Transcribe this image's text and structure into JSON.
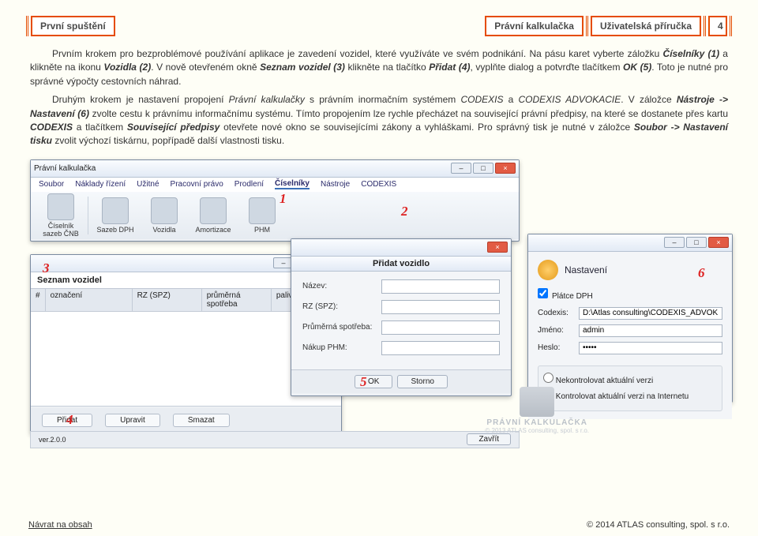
{
  "header": {
    "left": "První spuštění",
    "mid1": "Právní kalkulačka",
    "mid2": "Uživatelská příručka",
    "page": "4"
  },
  "p1_a": "Prvním krokem pro bezproblémové používání aplikace je zavedení vozidel, které využíváte ve svém podnikání. Na pásu karet vyberte záložku ",
  "p1_b": "Číselníky (1)",
  "p1_c": " a klikněte na ikonu ",
  "p1_d": "Vozidla (2)",
  "p1_e": ". V nově otevřeném okně ",
  "p1_f": "Seznam vozidel (3)",
  "p1_g": " klikněte na tlačítko ",
  "p1_h": "Přidat (4)",
  "p1_i": ", vyplňte dialog a potvrďte tlačítkem ",
  "p1_j": "OK (5)",
  "p1_k": ". Toto je nutné pro správné výpočty cestovních náhrad.",
  "p2_a": "Druhým krokem je nastavení propojení ",
  "p2_b": "Právní kalkulačky",
  "p2_c": " s právním inormačním systémem ",
  "p2_d": "CODEXIS",
  "p2_e": " a ",
  "p2_f": "CODEXIS ADVOKACIE",
  "p2_g": ". V záložce ",
  "p2_h": "Nástroje -> Nastavení (6)",
  "p2_i": " zvolte cestu k právnímu informačnímu systému. Tímto propojením lze rychle přecházet na související právní předpisy, na které se dostanete přes kartu ",
  "p2_j": "CODEXIS",
  "p2_k": " a tlačítkem ",
  "p2_l": "Související předpisy",
  "p2_m": " otevřete nové okno se souvisejícími zákony a vyhláškami. Pro správný tisk je nutné v záložce ",
  "p2_n": "Soubor -> Nastavení tisku",
  "p2_o": " zvolit výchozí tiskárnu, popřípadě další vlastnosti tisku.",
  "app": {
    "title": "Právní kalkulačka",
    "menu": [
      "Soubor",
      "Náklady řízení",
      "Užitné",
      "Pracovní právo",
      "Prodlení",
      "Číselníky",
      "Nástroje",
      "CODEXIS"
    ],
    "ribbon": [
      {
        "label": "Číselník sazeb ČNB"
      },
      {
        "label": "Sazeb DPH"
      },
      {
        "label": "Vozidla"
      },
      {
        "label": "Amortizace"
      },
      {
        "label": "PHM"
      }
    ],
    "ver": "ver.2.0.0",
    "close": "Zavřít"
  },
  "list": {
    "title": "Seznam vozidel",
    "cols": [
      "#",
      "označení",
      "RZ (SPZ)",
      "průměrná spotřeba",
      "palivo"
    ],
    "btn_add": "Přidat",
    "btn_edit": "Upravit",
    "btn_del": "Smazat"
  },
  "dlg": {
    "title": "Přidat vozidlo",
    "f1": "Název:",
    "f2": "RZ (SPZ):",
    "f3": "Průměrná spotřeba:",
    "f4": "Nákup PHM:",
    "ok": "OK",
    "cancel": "Storno"
  },
  "set": {
    "title": "Nastavení",
    "chk_dph": "Plátce DPH",
    "l_cx": "Codexis:",
    "v_cx": "D:\\Atlas consulting\\CODEXIS_ADVOK",
    "l_user": "Jméno:",
    "v_user": "admin",
    "l_pass": "Heslo:",
    "v_pass": "•••••",
    "r1": "Nekontrolovat aktuální verzi",
    "r2": "Kontrolovat aktuální verzi na Internetu"
  },
  "anno": {
    "a1": "1",
    "a2": "2",
    "a3": "3",
    "a4": "4",
    "a5": "5",
    "a6": "6"
  },
  "watermark": {
    "name": "PRÁVNÍ KALKULAČKA",
    "sub": "© 2013 ATLAS consulting, spol. s r.o."
  },
  "footer": {
    "left": "Návrat na obsah",
    "right": "© 2014 ATLAS consulting, spol. s r.o."
  }
}
